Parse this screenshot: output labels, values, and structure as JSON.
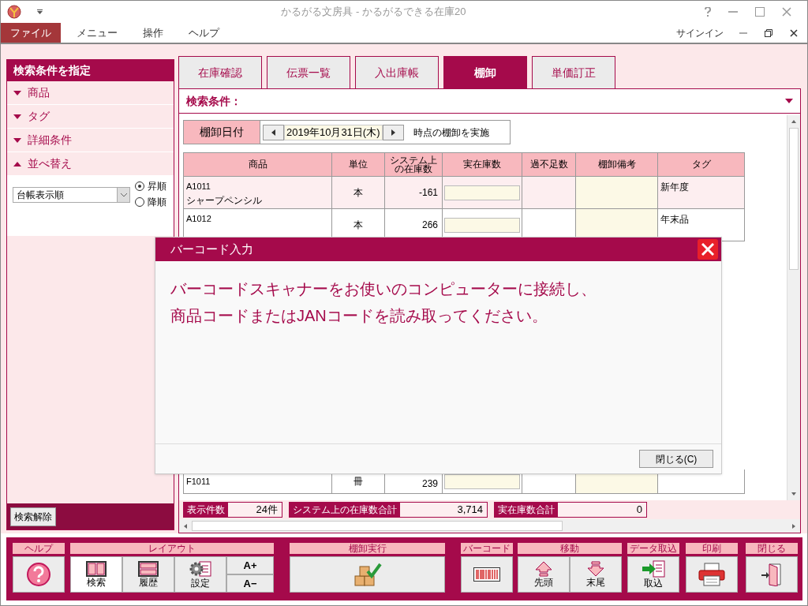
{
  "window": {
    "title": "かるがる文房具 - かるがるできる在庫20"
  },
  "menu": [
    {
      "label": "ファイル",
      "selected": true
    },
    {
      "label": "メニュー",
      "selected": false
    },
    {
      "label": "操作",
      "selected": false
    },
    {
      "label": "ヘルプ",
      "selected": false
    }
  ],
  "account": {
    "label": "サインイン"
  },
  "sidebar": {
    "title": "検索条件を指定",
    "sections": [
      {
        "label": "商品",
        "expanded": false
      },
      {
        "label": "タグ",
        "expanded": false
      },
      {
        "label": "詳細条件",
        "expanded": false
      },
      {
        "label": "並べ替え",
        "expanded": true
      }
    ],
    "sort": {
      "value": "台帳表示順",
      "options": [
        {
          "label": "昇順",
          "selected": true
        },
        {
          "label": "降順",
          "selected": false
        }
      ]
    },
    "clear_button": "検索解除"
  },
  "tabs": [
    {
      "label": "在庫確認",
      "selected": false
    },
    {
      "label": "伝票一覧",
      "selected": false
    },
    {
      "label": "入出庫帳",
      "selected": false
    },
    {
      "label": "棚卸",
      "selected": true
    },
    {
      "label": "単価訂正",
      "selected": false
    }
  ],
  "search_conditions": {
    "label": "検索条件："
  },
  "date_row": {
    "label": "棚卸日付",
    "date": "2019年10月31日(木)",
    "suffix": "時点の棚卸を実施"
  },
  "table": {
    "columns": [
      "商品",
      "単位",
      "システム上の在庫数",
      "実在庫数",
      "過不足数",
      "棚卸備考",
      "タグ"
    ],
    "rows": [
      {
        "code": "A1011",
        "name": "シャープペンシル",
        "unit": "本",
        "system_stock": "-161",
        "tag": "新年度",
        "selected": true
      },
      {
        "code": "A1012",
        "unit": "本",
        "system_stock": "266",
        "tag": "年末品",
        "selected": false
      },
      {
        "code": "F1011",
        "unit": "冊",
        "system_stock": "239",
        "selected": false
      }
    ]
  },
  "summary": [
    {
      "label": "表示件数",
      "value": "24件"
    },
    {
      "label": "システム上の在庫数合計",
      "value": "3,714"
    },
    {
      "label": "実在庫数合計",
      "value": "0"
    }
  ],
  "dialog": {
    "title": "バーコード入力",
    "message": [
      "バーコードスキャナーをお使いのコンピューターに接続し、",
      "商品コードまたはJANコードを読み取ってください。"
    ],
    "button": "閉じる(C)"
  },
  "toolbar": [
    {
      "label": "ヘルプ",
      "buttons": [
        {
          "kind": "help"
        }
      ]
    },
    {
      "label": "レイアウト",
      "buttons": [
        {
          "kind": "search-layout",
          "label": "検索",
          "selected": true
        },
        {
          "kind": "history-layout",
          "label": "履歴",
          "selected": false
        },
        {
          "kind": "settings",
          "label": "設定",
          "selected": false
        },
        {
          "kind": "font-size",
          "labels": [
            "A+",
            "A−"
          ]
        }
      ]
    },
    {
      "label": "棚卸実行",
      "buttons": [
        {
          "kind": "boxes-check"
        }
      ]
    },
    {
      "label": "バーコード",
      "buttons": [
        {
          "kind": "barcode"
        }
      ]
    },
    {
      "label": "移動",
      "buttons": [
        {
          "kind": "up",
          "label": "先頭"
        },
        {
          "kind": "down",
          "label": "末尾"
        }
      ]
    },
    {
      "label": "データ取込",
      "buttons": [
        {
          "kind": "import",
          "label": "取込"
        }
      ]
    },
    {
      "label": "印刷",
      "buttons": [
        {
          "kind": "print"
        }
      ]
    },
    {
      "label": "閉じる",
      "buttons": [
        {
          "kind": "exit"
        }
      ]
    }
  ]
}
